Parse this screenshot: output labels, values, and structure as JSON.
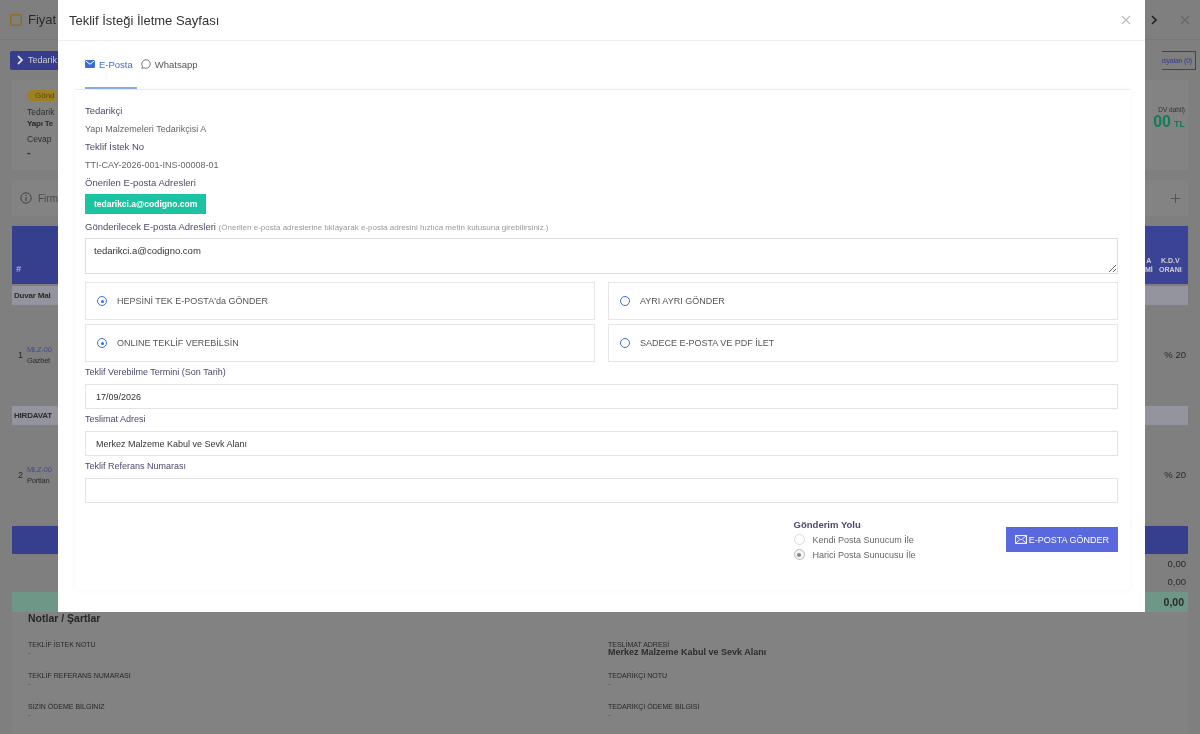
{
  "background_page": {
    "title": "Fiyat",
    "left": {
      "supplier_button": "Tedarik",
      "status_badge": "Gönd",
      "supplier_label": "Tedarik",
      "supplier_name": "Yapı Te",
      "reply_label": "Cevap",
      "reply_value": "-",
      "info_text": "Firm",
      "table_header": "#",
      "rows": [
        {
          "kind": "group",
          "text": "Duvar Mal"
        },
        {
          "kind": "item",
          "number": "1",
          "code": "MLZ-00",
          "name": "Gazbet"
        },
        {
          "kind": "group",
          "text": "HIRDAVAT"
        },
        {
          "kind": "item",
          "number": "2",
          "code": "MLZ-00",
          "name": "Portlan"
        }
      ]
    },
    "right": {
      "attachments_button": "ısyalan (0)",
      "total_caption": "DV dahil)",
      "total_value": "00",
      "total_currency": "TL",
      "columns": [
        "A Mİ",
        "K.D.V ORANI"
      ],
      "rows": [
        {
          "kind": "group"
        },
        {
          "kind": "item",
          "vat": "% 20"
        },
        {
          "kind": "group"
        },
        {
          "kind": "item",
          "vat": "% 20"
        }
      ],
      "totals": [
        "0,00",
        "0,00"
      ],
      "grand_total": "0,00"
    }
  },
  "modal": {
    "title": "Teklif İsteği İletme Sayfası",
    "tabs": [
      {
        "label": "E-Posta",
        "kind": "email",
        "selected": true
      },
      {
        "label": "Whatsapp",
        "kind": "whatsapp",
        "selected": false
      }
    ],
    "supplier_label": "Tedarikçi",
    "supplier": "Yapı Malzemeleri Tedarikçisi A",
    "request_no_label": "Teklif İstek No",
    "request_no": "TTI-CAY-2026-001-INS-00008-01",
    "suggested_label": "Önerilen E-posta Adresleri",
    "suggested_emails": [
      "tedarikci.a@codigno.com"
    ],
    "recipients_label": "Gönderilecek E-posta Adresleri",
    "recipients_hint": "(Önerilen e-posta adreslerine tıklayarak e-posta adresini hızlıca metin kutusuna girebilirsiniz.)",
    "recipients": "tedarikci.a@codigno.com",
    "option_rows": [
      [
        {
          "label": "HEPSİNİ TEK E-POSTA'da GÖNDER",
          "selected": true
        },
        {
          "label": "AYRI AYRI GÖNDER",
          "selected": false
        }
      ],
      [
        {
          "label": "ONLINE TEKLİF VEREBİLSİN",
          "selected": true
        },
        {
          "label": "SADECE E-POSTA VE PDF İLET",
          "selected": false
        }
      ]
    ],
    "fields": [
      {
        "label": "Teklif Verebilme Termini (Son Tarih)",
        "value": "17/09/2026"
      },
      {
        "label": "Teslimat Adresi",
        "value": "Merkez Malzeme Kabul ve Sevk Alanı"
      },
      {
        "label": "Teklif Referans Numarası"
      }
    ],
    "delivery_title": "Gönderim Yolu",
    "delivery_options": [
      {
        "label": "Kendi Posta Sunucum İle",
        "selected": false
      },
      {
        "label": "Harici Posta Sunucusu İle",
        "selected": true
      }
    ],
    "send_button": "E-POSTA GÖNDER"
  },
  "notes": {
    "title": "Notlar / Şartlar",
    "columns": [
      [
        {
          "label": "TEKLİF İSTEK NOTU",
          "value": "-"
        },
        {
          "label": "TEKLİF REFERANS NUMARASI",
          "value": "-"
        },
        {
          "label": "SİZİN ÖDEME BİLGİNİZ",
          "value": "-"
        }
      ],
      [
        {
          "label": "TESLİMAT ADRESİ",
          "value": "Merkez Malzeme Kabul ve Sevk Alanı"
        },
        {
          "label": "TEDARİKÇİ NOTU",
          "value": "-"
        },
        {
          "label": "TEDARİKÇİ ÖDEME BİLGİSİ",
          "value": "-"
        }
      ]
    ]
  }
}
